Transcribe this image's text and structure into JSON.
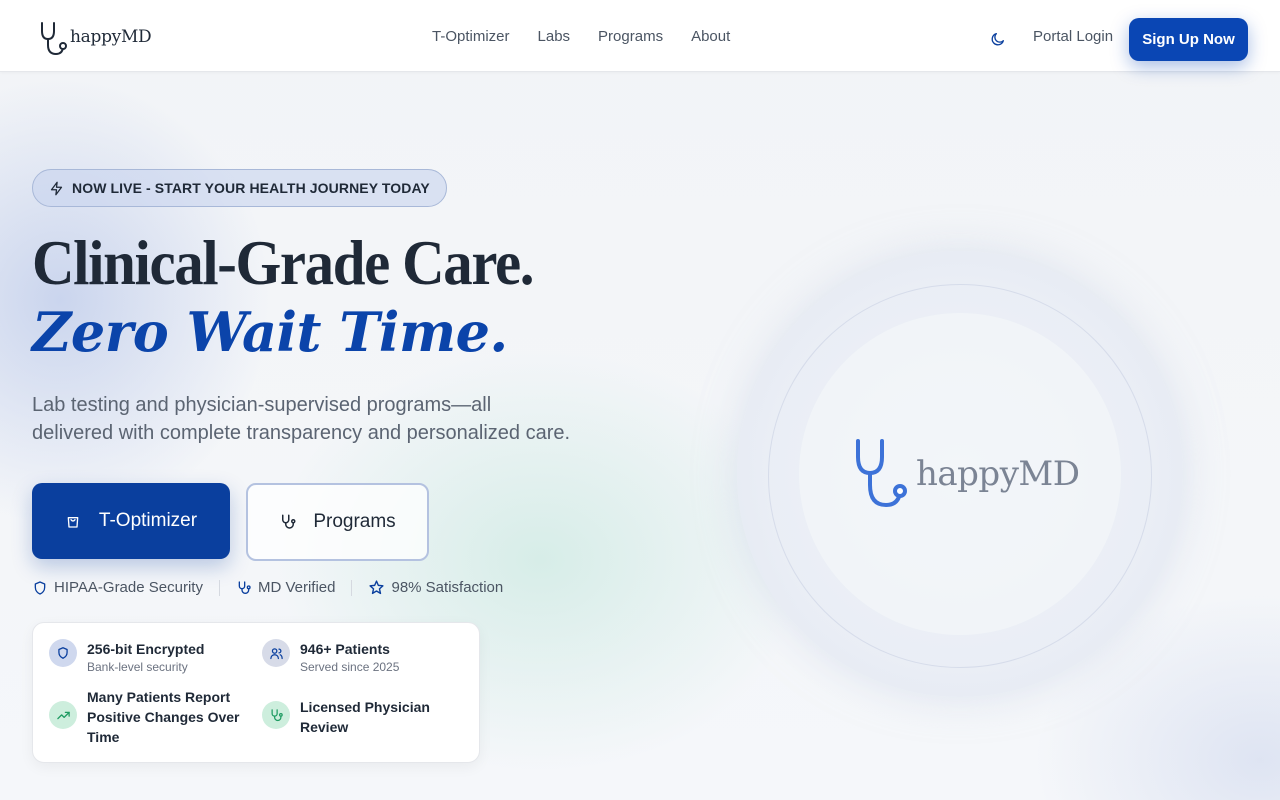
{
  "brand": {
    "name": "happyMD"
  },
  "nav": {
    "links": [
      "T-Optimizer",
      "Labs",
      "Programs",
      "About"
    ],
    "portal_label": "Portal Login",
    "signup_label": "Sign Up Now"
  },
  "hero": {
    "badge": "NOW LIVE - START YOUR HEALTH JOURNEY TODAY",
    "headline_1": "Clinical-Grade Care.",
    "headline_2": "Zero Wait Time.",
    "lead": "Lab testing and physician-supervised programs—all delivered with complete transparency and personalized care.",
    "cta_primary": "T-Optimizer",
    "cta_secondary": "Programs",
    "trust": [
      "HIPAA-Grade Security",
      "MD Verified",
      "98% Satisfaction"
    ]
  },
  "features": [
    {
      "title": "256-bit Encrypted",
      "sub": "Bank-level security",
      "icon": "shield-icon"
    },
    {
      "title": "946+ Patients",
      "sub": "Served since 2025",
      "icon": "users-icon"
    },
    {
      "title": "Many Patients Report Positive Changes Over Time",
      "sub": "",
      "icon": "trend-up-icon"
    },
    {
      "title": "Licensed Physician Review",
      "sub": "",
      "icon": "stethoscope-icon"
    }
  ],
  "colors": {
    "primary": "#0a46b4",
    "headline_accent": "#0b44aa",
    "text": "#1f2937",
    "muted": "#5b6472"
  }
}
